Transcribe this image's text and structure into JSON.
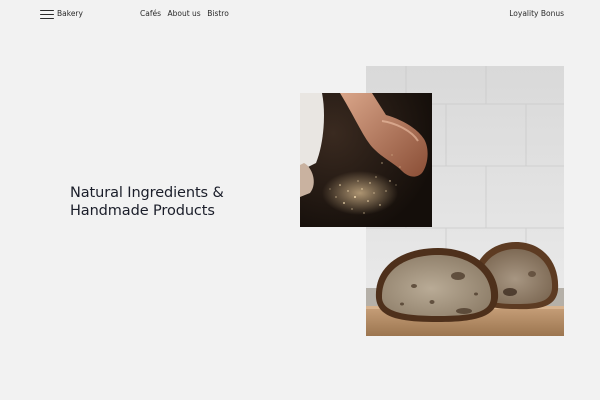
{
  "header": {
    "brand": "Bakery",
    "nav": [
      {
        "label": "Cafés"
      },
      {
        "label": "About us"
      },
      {
        "label": "Bistro"
      }
    ],
    "loyalty": "Loyality Bonus",
    "menu_icon": "hamburger-menu-icon"
  },
  "hero": {
    "headline_line1": "Natural Ingredients &",
    "headline_line2": "Handmade Products"
  },
  "images": {
    "flour": "hands-sprinkling-flour-photo",
    "bread": "sourdough-bread-loaves-photo"
  },
  "colors": {
    "background": "#f2f2f2",
    "text": "#1b1e2a"
  }
}
